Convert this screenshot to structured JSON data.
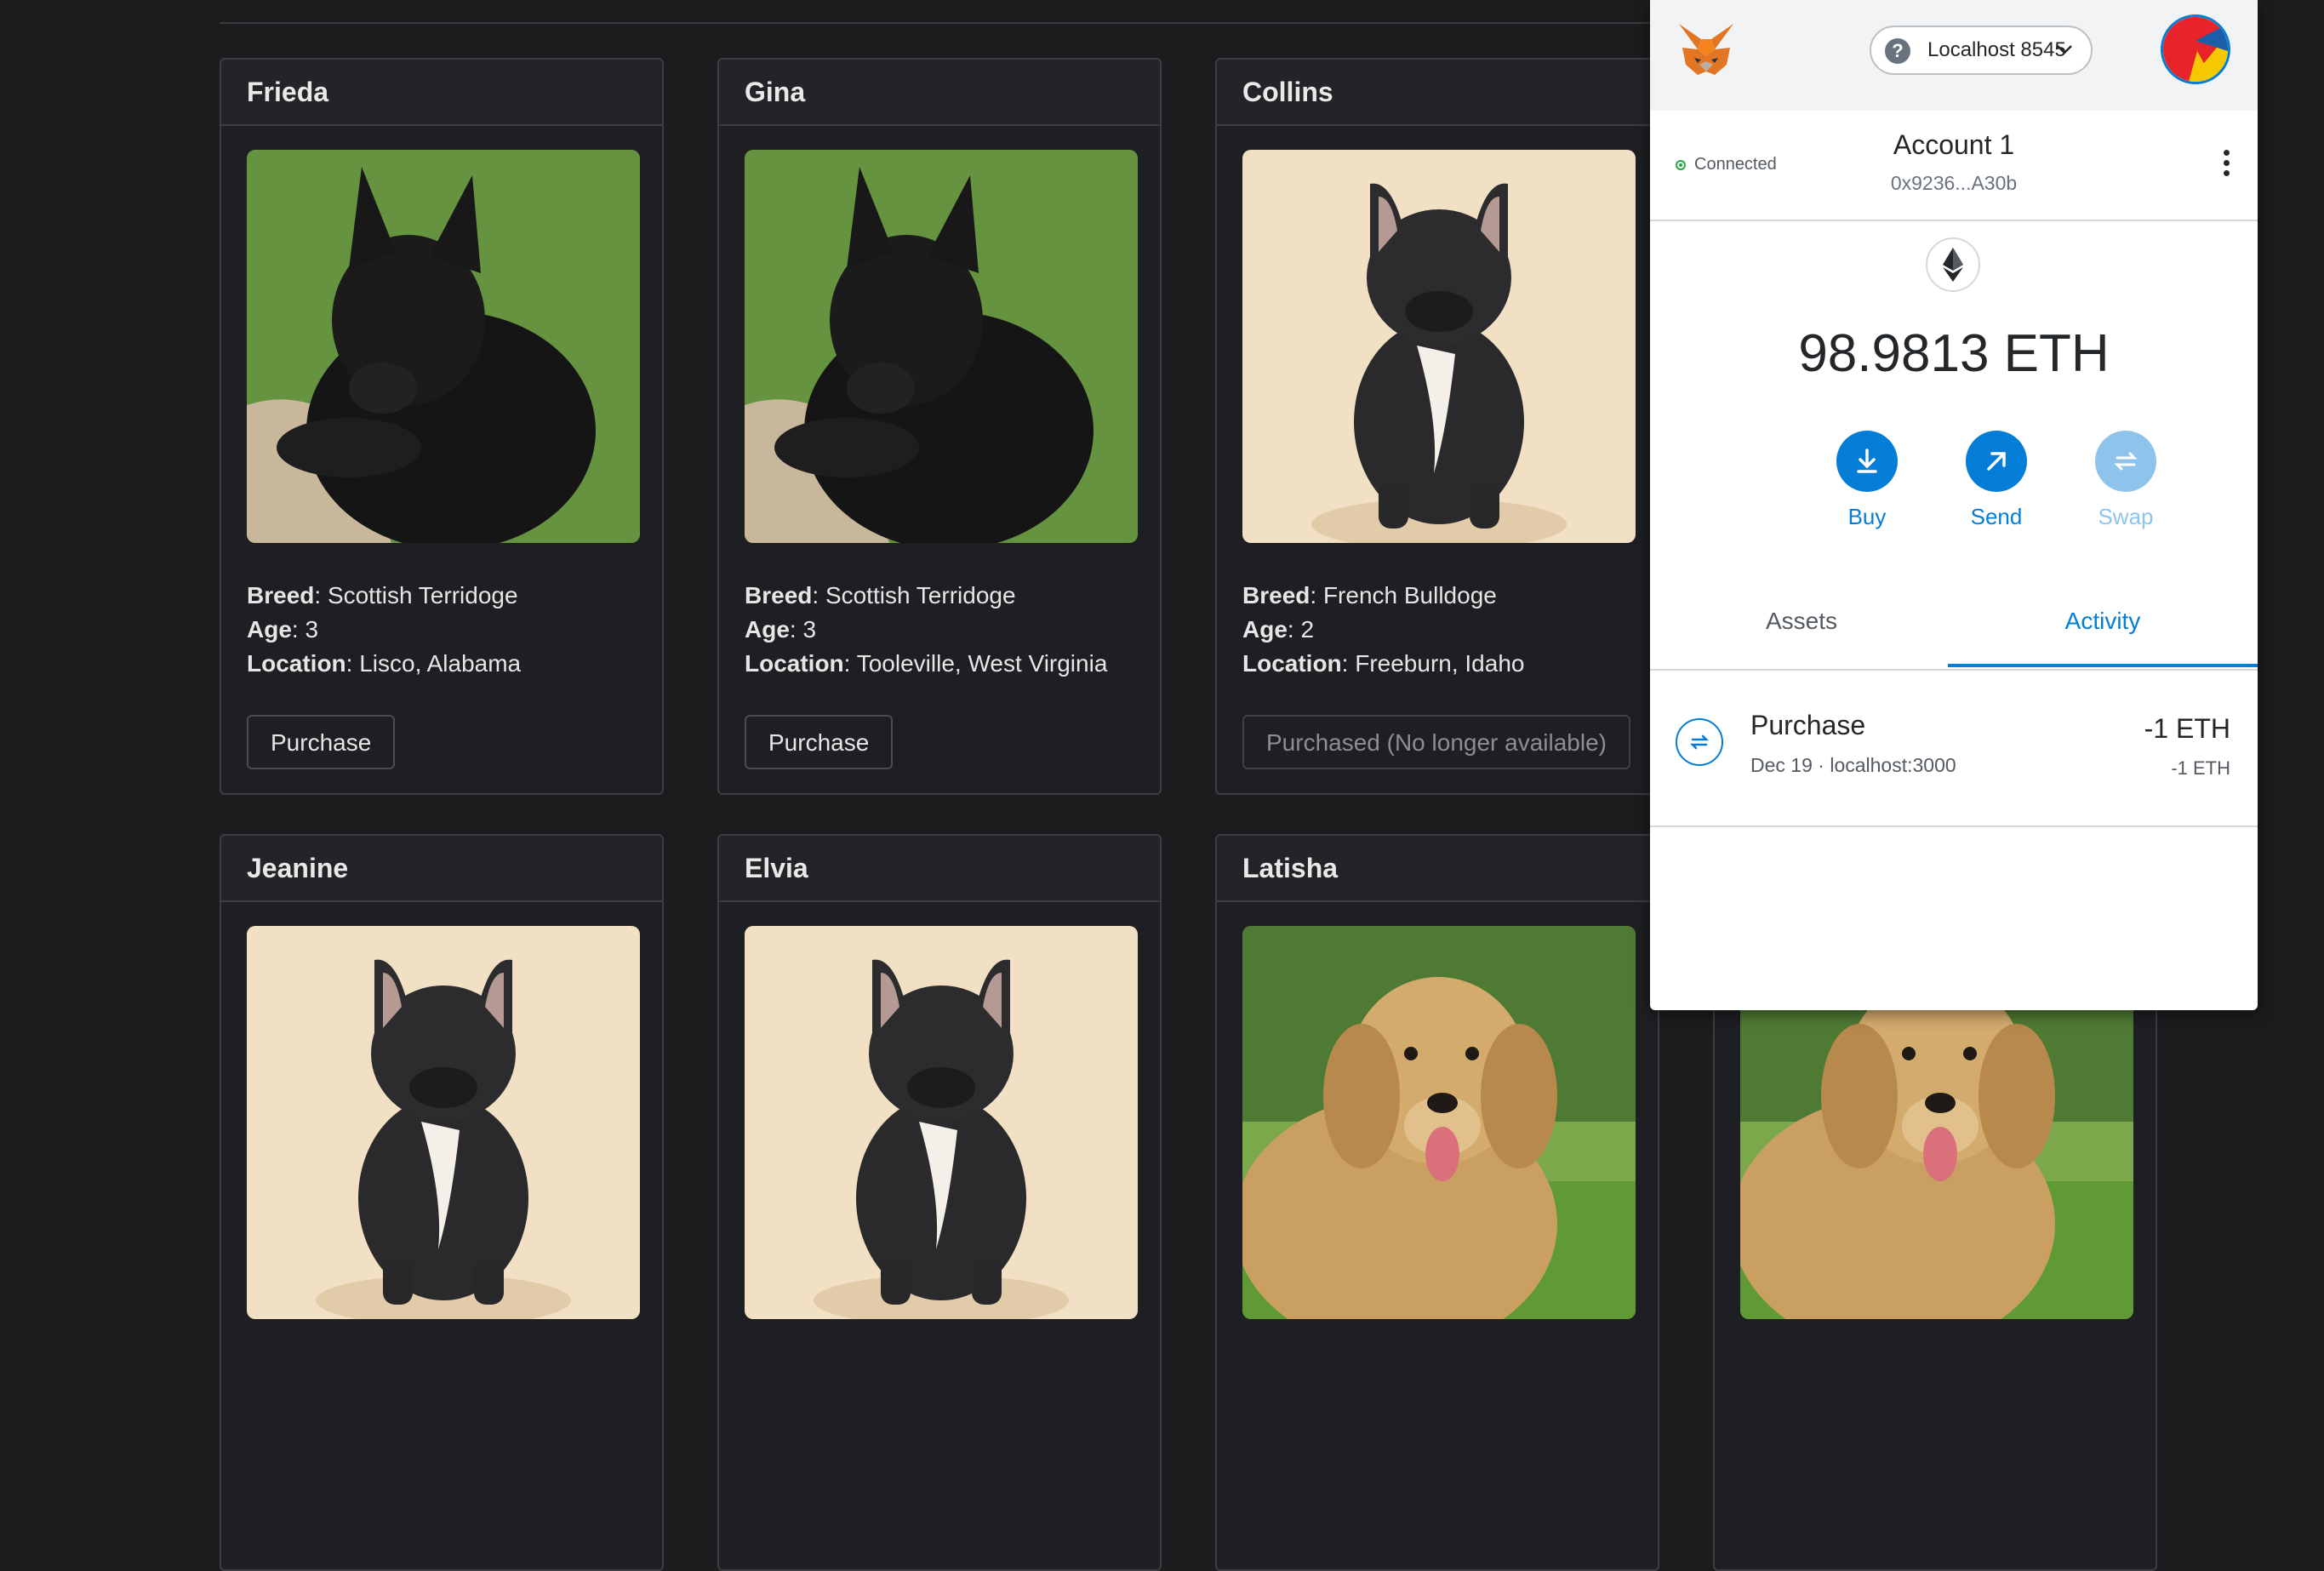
{
  "pets": [
    {
      "name": "Frieda",
      "breed_label": "Breed",
      "breed": "Scottish Terridoge",
      "age_label": "Age",
      "age": "3",
      "location_label": "Location",
      "location": "Lisco, Alabama",
      "button": "Purchase",
      "available": true,
      "image": "scottish-terrier"
    },
    {
      "name": "Gina",
      "breed_label": "Breed",
      "breed": "Scottish Terridoge",
      "age_label": "Age",
      "age": "3",
      "location_label": "Location",
      "location": "Tooleville, West Virginia",
      "button": "Purchase",
      "available": true,
      "image": "scottish-terrier"
    },
    {
      "name": "Collins",
      "breed_label": "Breed",
      "breed": "French Bulldoge",
      "age_label": "Age",
      "age": "2",
      "location_label": "Location",
      "location": "Freeburn, Idaho",
      "button": "Purchased (No longer available)",
      "available": false,
      "image": "french-bulldog"
    },
    {
      "name": "Jeanine",
      "image": "french-bulldog"
    },
    {
      "name": "Elvia",
      "image": "french-bulldog"
    },
    {
      "name": "Latisha",
      "image": "golden-retriever"
    },
    {
      "name": "",
      "image": "golden-retriever"
    }
  ],
  "wallet": {
    "logo_icon": "metamask-fox-icon",
    "network": "Localhost 8545",
    "network_icon": "question-icon",
    "status": "Connected",
    "account_name": "Account 1",
    "account_address": "0x9236...A30b",
    "balance": "98.9813 ETH",
    "actions": [
      {
        "label": "Buy",
        "icon": "download-icon",
        "enabled": true
      },
      {
        "label": "Send",
        "icon": "arrow-up-right-icon",
        "enabled": true
      },
      {
        "label": "Swap",
        "icon": "swap-icon",
        "enabled": false
      }
    ],
    "tabs": [
      {
        "label": "Assets",
        "active": false
      },
      {
        "label": "Activity",
        "active": true
      }
    ],
    "activity": [
      {
        "title": "Purchase",
        "date": "Dec 19",
        "separator": "·",
        "origin": "localhost:3000",
        "amount": "-1 ETH",
        "amount_secondary": "-1 ETH"
      }
    ],
    "accent_color": "#037dd6"
  }
}
